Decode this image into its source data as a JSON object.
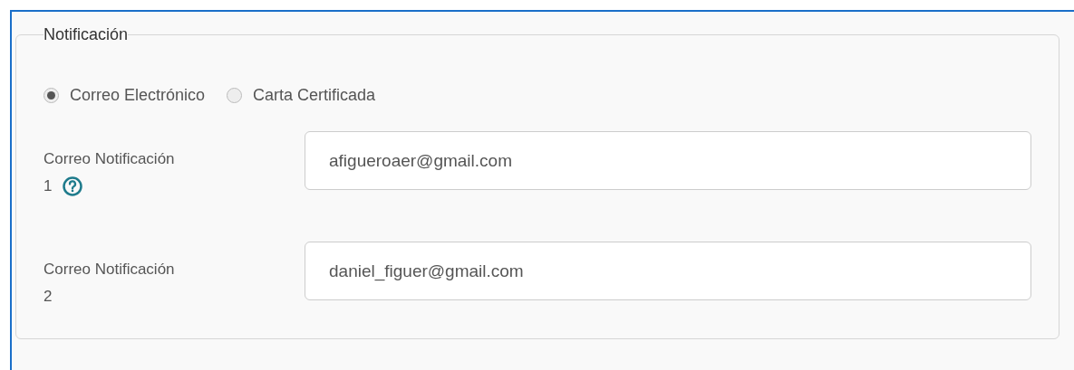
{
  "section": {
    "legend": "Notificación",
    "radios": [
      {
        "label": "Correo Electrónico",
        "selected": true
      },
      {
        "label": "Carta Certificada",
        "selected": false
      }
    ],
    "fields": [
      {
        "label": "Correo Notificación",
        "number": "1",
        "help": true,
        "value": "afigueroaer@gmail.com"
      },
      {
        "label": "Correo Notificación",
        "number": "2",
        "help": false,
        "value": "daniel_figuer@gmail.com"
      }
    ]
  }
}
